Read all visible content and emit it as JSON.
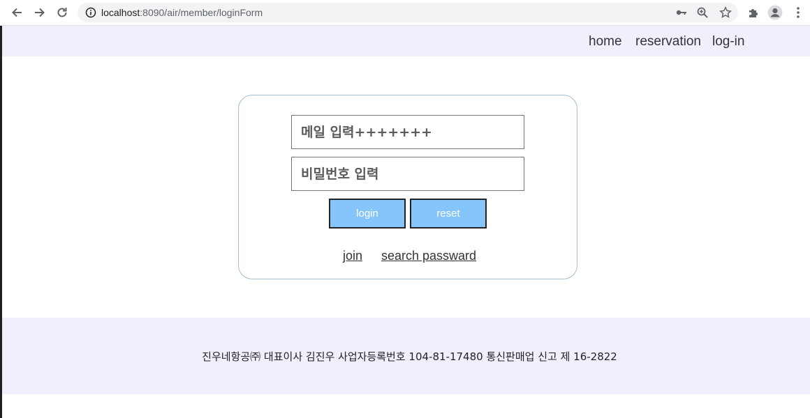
{
  "browser": {
    "url_host": "localhost",
    "url_path": ":8090/air/member/loginForm",
    "icons": [
      "back-arrow-icon",
      "forward-arrow-icon",
      "reload-icon",
      "info-icon",
      "key-icon",
      "zoom-icon",
      "star-icon",
      "puzzle-icon",
      "profile-icon",
      "kebab-menu-icon"
    ]
  },
  "nav": {
    "items": [
      {
        "label": "home"
      },
      {
        "label": "reservation"
      },
      {
        "label": "log-in"
      }
    ]
  },
  "login": {
    "email_placeholder": "메일 입력+++++++",
    "password_placeholder": "비밀번호 입력",
    "login_button": "login",
    "reset_button": "reset",
    "join_link": "join",
    "search_password_link": "search passward"
  },
  "footer": {
    "text": "진우네항공㈜ 대표이사 김진우 사업자등록번호 104-81-17480 통신판매업 신고 제 16-2822"
  },
  "colors": {
    "nav_bg": "#f2effc",
    "button_bg": "#86c5fb",
    "box_border": "#a5bcd6"
  }
}
